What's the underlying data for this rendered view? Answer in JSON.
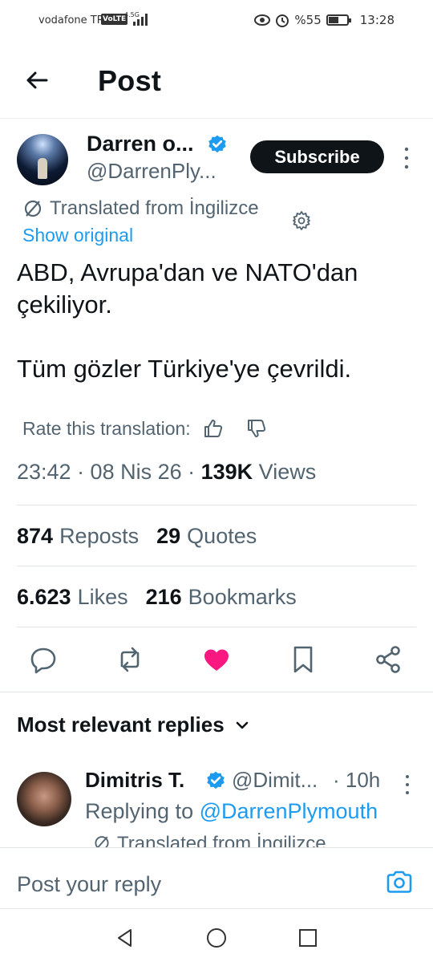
{
  "status_bar": {
    "carrier": "vodafone TR",
    "volte": "VoLTE",
    "network": "4.5G",
    "battery": "%55",
    "battery_level": 0.55,
    "time": "13:28"
  },
  "header": {
    "title": "Post"
  },
  "post": {
    "author_name": "Darren o...",
    "author_handle": "@DarrenPly...",
    "subscribe_label": "Subscribe",
    "translated_label": "Translated from İngilizce",
    "show_original": "Show original",
    "text": "ABD, Avrupa'dan ve NATO'dan\nçekiliyor.\n\nTüm gözler Türkiye'ye çevrildi.",
    "rate_label": "Rate this translation:",
    "time": "23:42 · 08 Nis 26 · ",
    "views_count": "139K",
    "views_label": " Views"
  },
  "stats": {
    "reposts_count": "874",
    "reposts_label": "Reposts",
    "quotes_count": "29",
    "quotes_label": "Quotes",
    "likes_count": "6.623",
    "likes_label": "Likes",
    "bookmarks_count": "216",
    "bookmarks_label": "Bookmarks"
  },
  "colors": {
    "accent": "#1d9bf0",
    "like": "#f91880",
    "text_primary": "#0f1419",
    "text_secondary": "#536471"
  },
  "replies": {
    "heading": "Most relevant replies",
    "items": [
      {
        "name": "Dimitris T.",
        "handle": "@Dimit...",
        "time": "· 10h",
        "replying_prefix": "Replying to ",
        "replying_to": "@DarrenPlymouth",
        "translated_label": "Translated from İngilizce"
      }
    ]
  },
  "compose": {
    "placeholder": "Post your reply"
  }
}
